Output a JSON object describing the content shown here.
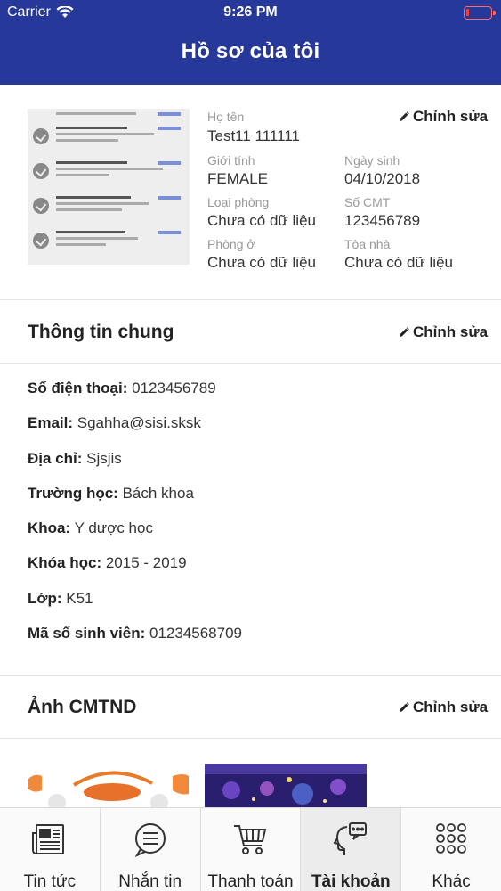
{
  "status_bar": {
    "carrier": "Carrier",
    "time": "9:26 PM"
  },
  "header": {
    "title": "Hồ sơ của tôi"
  },
  "profile": {
    "edit_label": "Chỉnh sửa",
    "name_label": "Họ tên",
    "name_value": "Test11 111111",
    "gender_label": "Giới tính",
    "gender_value": "FEMALE",
    "birthday_label": "Ngày sinh",
    "birthday_value": "04/10/2018",
    "room_type_label": "Loại phòng",
    "room_type_value": "Chưa có dữ liệu",
    "id_number_label": "Số CMT",
    "id_number_value": "123456789",
    "room_label": "Phòng ở",
    "room_value": "Chưa có dữ liệu",
    "building_label": "Tòa nhà",
    "building_value": "Chưa có dữ liệu"
  },
  "general": {
    "title": "Thông tin chung",
    "edit_label": "Chỉnh sửa",
    "rows": [
      {
        "label": "Số điện thoại:",
        "value": "0123456789"
      },
      {
        "label": "Email:",
        "value": "Sgahha@sisi.sksk"
      },
      {
        "label": "Địa chỉ:",
        "value": "Sjsjis"
      },
      {
        "label": "Trường học:",
        "value": "Bách khoa"
      },
      {
        "label": "Khoa:",
        "value": "Y dược học"
      },
      {
        "label": "Khóa học:",
        "value": "2015 - 2019"
      },
      {
        "label": "Lớp:",
        "value": "K51"
      },
      {
        "label": "Mã số sinh viên:",
        "value": "01234568709"
      }
    ]
  },
  "id_photos": {
    "title": "Ảnh CMTND",
    "edit_label": "Chỉnh sửa"
  },
  "tabbar": {
    "tabs": [
      {
        "label": "Tin tức",
        "icon": "newspaper-icon"
      },
      {
        "label": "Nhắn tin",
        "icon": "chat-bubble-icon"
      },
      {
        "label": "Thanh toán",
        "icon": "shopping-cart-icon"
      },
      {
        "label": "Tài khoản",
        "icon": "account-head-icon",
        "active": true
      },
      {
        "label": "Khác",
        "icon": "grid-dots-icon"
      }
    ]
  },
  "colors": {
    "header_bg": "#26399a",
    "active_tab_bg": "#ececec",
    "divider": "#e4e4e4"
  }
}
